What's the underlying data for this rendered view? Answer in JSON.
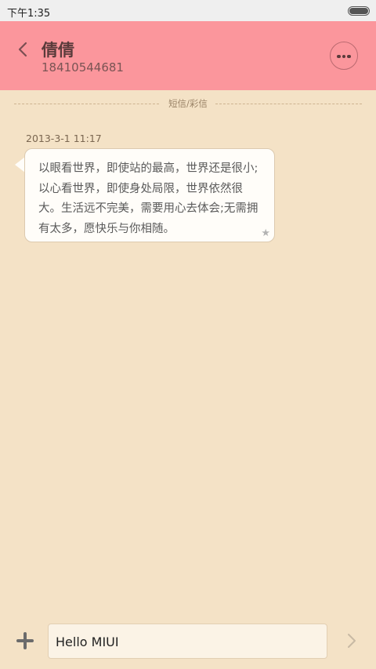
{
  "status_bar": {
    "time": "下午1:35",
    "battery_level": 1.0
  },
  "header": {
    "contact_name": "倩倩",
    "contact_number": "18410544681",
    "back_icon": "chevron-left-icon",
    "more_icon": "more-dots-icon",
    "bg_color": "#fb969c"
  },
  "conversation": {
    "divider_label": "短信/彩信",
    "messages": [
      {
        "timestamp": "2013-3-1 11:17",
        "text": "以眼看世界，即使站的最高，世界还是很小;以心看世界，即使身处局限，世界依然很大。生活远不完美，需要用心去体会;无需拥有太多，愿快乐与你相随。",
        "star_icon": "star-icon"
      }
    ]
  },
  "composer": {
    "add_icon": "plus-icon",
    "input_value": "Hello MIUI",
    "send_icon": "chevron-right-icon"
  }
}
